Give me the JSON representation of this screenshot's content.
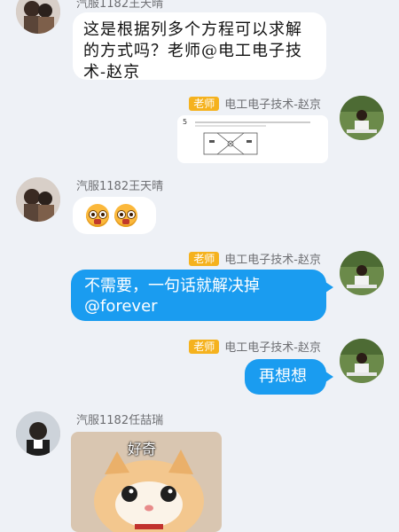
{
  "messages": [
    {
      "sender": "汽服1182王天晴",
      "text": "这是根据列多个方程可以求解的方式吗？老师@电工电子技术-赵京"
    },
    {
      "sender": "电工电子技术-赵京",
      "badge": "老师",
      "content": "image",
      "image_label": "5"
    },
    {
      "sender": "汽服1182王天晴",
      "content": "emoji",
      "emoji_names": [
        "surprised-face-icon",
        "surprised-face-icon"
      ]
    },
    {
      "sender": "电工电子技术-赵京",
      "badge": "老师",
      "text_line1": "不需要，一句话就解决掉",
      "text_line2": "@forever"
    },
    {
      "sender": "电工电子技术-赵京",
      "badge": "老师",
      "text": "再想想"
    },
    {
      "sender": "汽服1182任喆瑞",
      "content": "sticker",
      "sticker_text": "好奇"
    }
  ],
  "colors": {
    "background": "#eef1f6",
    "bubble_blue": "#1a9cf0",
    "badge": "#f5b21e"
  }
}
